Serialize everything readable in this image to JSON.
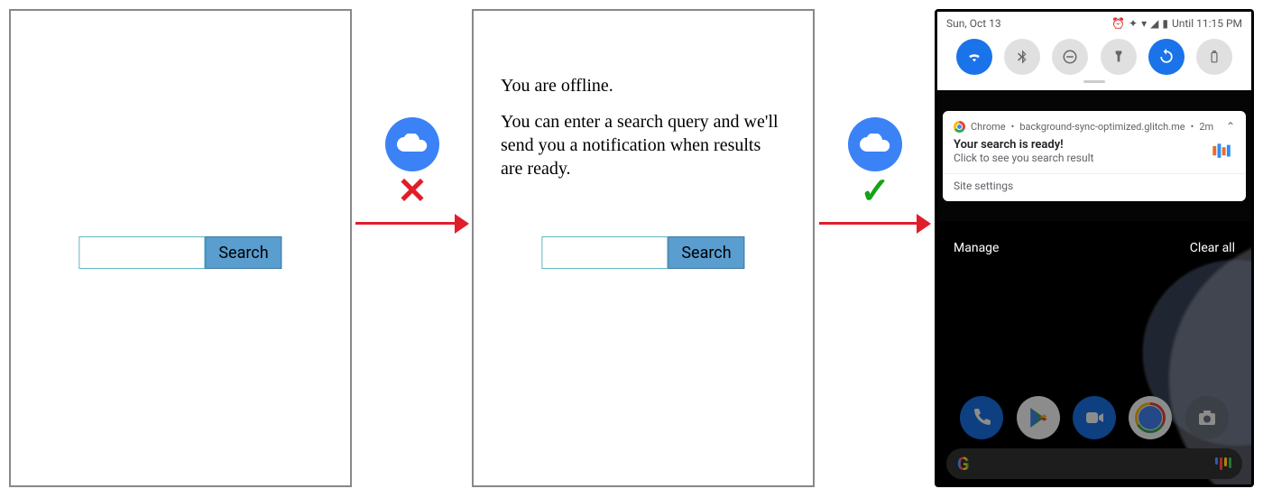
{
  "colors": {
    "brand_blue": "#3b82f6",
    "error": "#e11d2a",
    "success": "#17a317",
    "android_blue": "#1a73e8"
  },
  "panel1": {
    "search": {
      "value": "",
      "button_label": "Search"
    }
  },
  "transition1": {
    "cloud_icon": "cloud-icon",
    "status_mark": "✕",
    "status": "offline",
    "arrow_icon": "arrow-right-icon"
  },
  "panel2": {
    "offline_heading": "You are offline.",
    "offline_body": "You can enter a search query and we'll send you a notification when results are ready.",
    "search": {
      "value": "",
      "button_label": "Search"
    }
  },
  "transition2": {
    "cloud_icon": "cloud-icon",
    "status_mark": "✓",
    "status": "online",
    "arrow_icon": "arrow-right-icon"
  },
  "panel3": {
    "statusbar": {
      "date": "Sun, Oct 13",
      "battery_text": "Until 11:15 PM",
      "icons": [
        "alarm-icon",
        "vibrate-icon",
        "wifi-icon",
        "signal-icon",
        "battery-icon"
      ]
    },
    "quick_settings": [
      {
        "name": "wifi-icon",
        "active": true
      },
      {
        "name": "bluetooth-icon",
        "active": false
      },
      {
        "name": "dnd-icon",
        "active": false
      },
      {
        "name": "flashlight-icon",
        "active": false
      },
      {
        "name": "rotate-icon",
        "active": true
      },
      {
        "name": "battery-saver-icon",
        "active": false
      }
    ],
    "notification": {
      "app": "Chrome",
      "source": "background-sync-optimized.glitch.me",
      "time": "2m",
      "title": "Your search is ready!",
      "subtitle": "Click to see you search result",
      "site_settings_label": "Site settings"
    },
    "shade_actions": {
      "manage": "Manage",
      "clear_all": "Clear all"
    },
    "dock": [
      "phone-app",
      "play-store-app",
      "duo-app",
      "chrome-app",
      "camera-app"
    ],
    "google_bar": {
      "logo": "G",
      "assistant_icon": "assistant-icon"
    }
  }
}
